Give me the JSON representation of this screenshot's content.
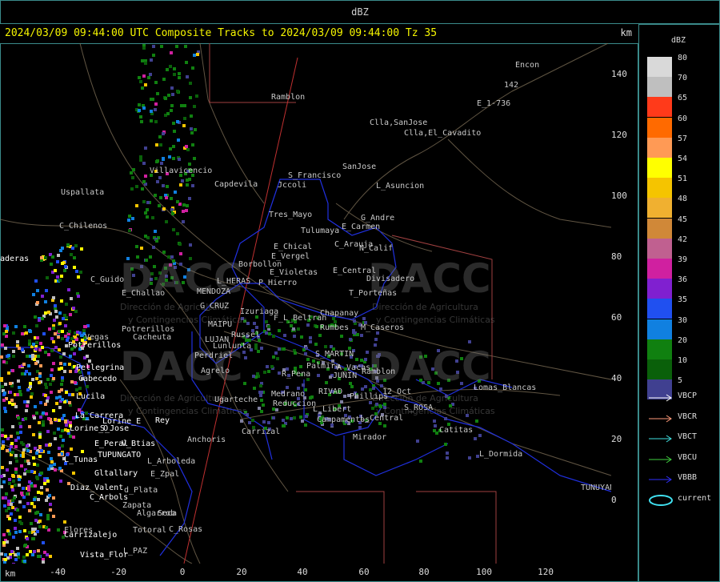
{
  "header": {
    "title": "dBZ"
  },
  "plot": {
    "title": "2024/03/09 09:44:00 UTC Composite Tracks to 2024/03/09 09:44:00 Tz 35",
    "unit_right": "km",
    "unit_bottom": "km"
  },
  "axes": {
    "x_ticks": [
      "-40",
      "-20",
      "0",
      "20",
      "40",
      "60",
      "80",
      "100",
      "120"
    ],
    "y_ticks": [
      "140",
      "120",
      "100",
      "80",
      "60",
      "40",
      "20",
      "0"
    ]
  },
  "legend": {
    "title": "dBZ",
    "items": [
      {
        "label": "80",
        "color": "#d9d9d9"
      },
      {
        "label": "70",
        "color": "#bfbfbf"
      },
      {
        "label": "65",
        "color": "#ff3a1a"
      },
      {
        "label": "60",
        "color": "#ff6a00"
      },
      {
        "label": "57",
        "color": "#ff9a55"
      },
      {
        "label": "54",
        "color": "#ffff00"
      },
      {
        "label": "51",
        "color": "#f5c400"
      },
      {
        "label": "48",
        "color": "#f0b030"
      },
      {
        "label": "45",
        "color": "#d08838"
      },
      {
        "label": "42",
        "color": "#c06090"
      },
      {
        "label": "39",
        "color": "#d020a0"
      },
      {
        "label": "36",
        "color": "#8020d0"
      },
      {
        "label": "35",
        "color": "#2050f0"
      },
      {
        "label": "30",
        "color": "#1080e0"
      },
      {
        "label": "20",
        "color": "#108010"
      },
      {
        "label": "10",
        "color": "#0a600a"
      },
      {
        "label": "5",
        "color": "#404090"
      }
    ],
    "tracks": [
      {
        "label": "VBCP",
        "color": "#ffffff"
      },
      {
        "label": "VBCR",
        "color": "#ff9a7a"
      },
      {
        "label": "VBCT",
        "color": "#40e0e0"
      },
      {
        "label": "VBCU",
        "color": "#40d040"
      },
      {
        "label": "VBBB",
        "color": "#3030ff"
      },
      {
        "label": "current",
        "color": "#40e0f0"
      }
    ]
  },
  "watermark": {
    "logo_text": "DACC",
    "line1": "Dirección de Agricultura",
    "line2": "y Contingencias Climáticas"
  },
  "places": [
    "Encon",
    "142",
    "E_1-736",
    "Ramblon",
    "Clla,SanJose",
    "Clla,El_Cavadito",
    "SanJose",
    "S_Francisco",
    "Jccoli",
    "L_Asuncion",
    "Villavicencio",
    "Capdevila",
    "Uspallata",
    "C_Chilenos",
    "Tres_Mayo",
    "Tulumaya",
    "G_Andre",
    "E_Carmen",
    "E_Chical",
    "E_Vergel",
    "C_Arauja",
    "N_Calif",
    "Borbollon",
    "E_Violetas",
    "E_Central",
    "Divisadero",
    "P_Hierro",
    "C_Guido",
    "L_HERAS",
    "MENDOZA",
    "E_Challao",
    "G_CRUZ",
    "Izuriaga",
    "T_Porteñas",
    "Chapanay",
    "F_L_Beltran",
    "Rumbes",
    "M_Caseros",
    "MAIPU",
    "Russel",
    "Potrerillos",
    "Vegas",
    "Cacheuta",
    "LUJAN",
    "Lunlunta",
    "Perdriel",
    "S_MARTIN",
    "Palmira",
    "A_Vacas",
    "Ramblon",
    "Agrelo",
    "R_Pena",
    "JUNIN",
    "RIVAD",
    "Phillips",
    "12_Oct",
    "Lomas_Blancas",
    "Medrano",
    "Reduccion",
    "L_Libert",
    "Campamentos",
    "L_Central",
    "S_ROSA",
    "Ugarteche",
    "Carrizal",
    "Catitas",
    "Mirador",
    "Anchoris",
    "L_Dormida",
    "L_Arboleda",
    "E_Zpal",
    "d_Plata",
    "Zapata",
    "Algarrob",
    "Seca",
    "Totoral",
    "C_Rosas",
    "TUNUYAN",
    "L_PAZ",
    "Flores",
    "Eler"
  ],
  "white_places": [
    "Potrerillos",
    "Pellegrina",
    "Cabecedo",
    "Lucila",
    "La_Carrera",
    "Lorine_E",
    "Lorine_O",
    "S_Jose",
    "E_Peral",
    "V_Btias",
    "TUPUNGATO",
    "L_Tunas",
    "Gltallary",
    "Diaz_Valent",
    "C_Arbols",
    "Carrizalejo",
    "Vista_Flor",
    "aderas",
    "Rey"
  ]
}
